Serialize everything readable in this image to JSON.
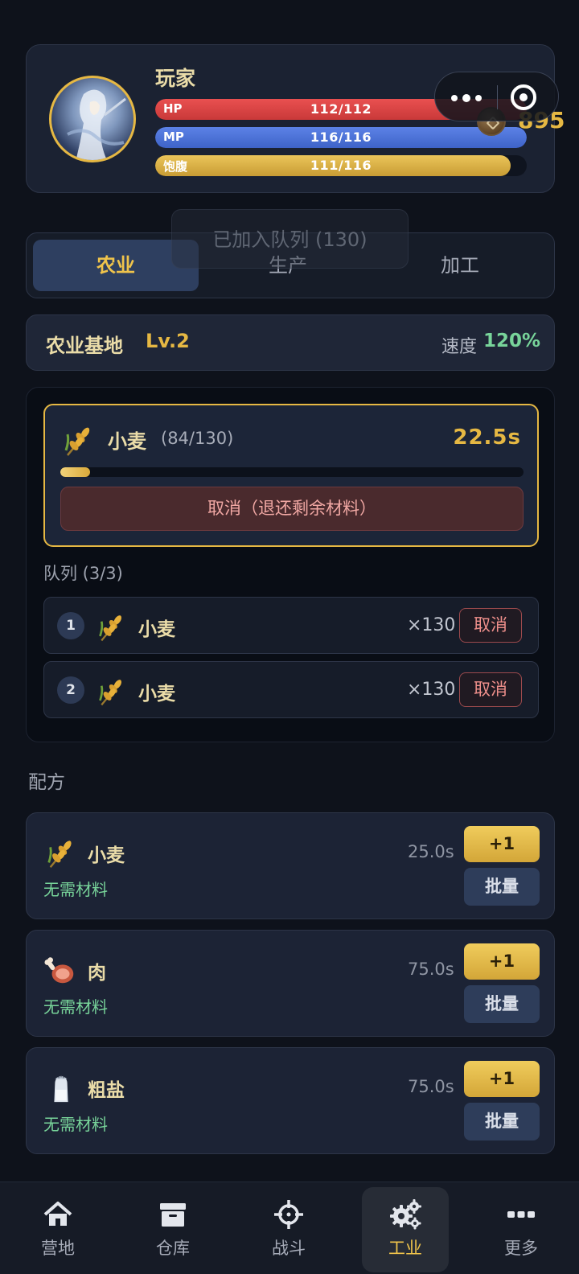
{
  "player": {
    "name": "玩家",
    "coins": "895",
    "hp": {
      "label": "HP",
      "value": "112/112",
      "fraction": 1.0
    },
    "mp": {
      "label": "MP",
      "value": "116/116",
      "fraction": 1.0
    },
    "satiety": {
      "label": "饱腹",
      "value": "111/116",
      "fraction": 0.957
    }
  },
  "toast": "已加入队列 (130)",
  "tabs": [
    {
      "label": "农业",
      "active": true
    },
    {
      "label": "生产",
      "active": false
    },
    {
      "label": "加工",
      "active": false
    }
  ],
  "base": {
    "name": "农业基地",
    "level": "Lv.2",
    "speed_label": "速度",
    "speed_value": "120%"
  },
  "active_job": {
    "name": "小麦",
    "count": "(84/130)",
    "time_left": "22.5s",
    "progress": 0.065,
    "cancel_label": "取消（退还剩余材料）",
    "icon": "wheat-icon"
  },
  "queue": {
    "title": "队列 (3/3)",
    "items": [
      {
        "num": "1",
        "name": "小麦",
        "qty": "×130",
        "cancel": "取消",
        "icon": "wheat-icon"
      },
      {
        "num": "2",
        "name": "小麦",
        "qty": "×130",
        "cancel": "取消",
        "icon": "wheat-icon"
      }
    ]
  },
  "recipes_title": "配方",
  "recipes": [
    {
      "name": "小麦",
      "materials": "无需材料",
      "time": "25.0s",
      "plus": "+1",
      "batch": "批量",
      "icon": "wheat-icon"
    },
    {
      "name": "肉",
      "materials": "无需材料",
      "time": "75.0s",
      "plus": "+1",
      "batch": "批量",
      "icon": "meat-icon"
    },
    {
      "name": "粗盐",
      "materials": "无需材料",
      "time": "75.0s",
      "plus": "+1",
      "batch": "批量",
      "icon": "salt-shaker-icon"
    }
  ],
  "nav": [
    {
      "label": "营地",
      "icon": "home-icon",
      "active": false
    },
    {
      "label": "仓库",
      "icon": "storage-box-icon",
      "active": false
    },
    {
      "label": "战斗",
      "icon": "crosshair-icon",
      "active": false
    },
    {
      "label": "工业",
      "icon": "gears-icon",
      "active": true
    },
    {
      "label": "更多",
      "icon": "more-dots-icon",
      "active": false
    }
  ],
  "colors": {
    "accent": "#e6b843",
    "hp": "#e24848",
    "mp": "#4e72d9",
    "satiety": "#e0b648",
    "positive": "#78d49a",
    "danger": "#ee8f8b"
  }
}
